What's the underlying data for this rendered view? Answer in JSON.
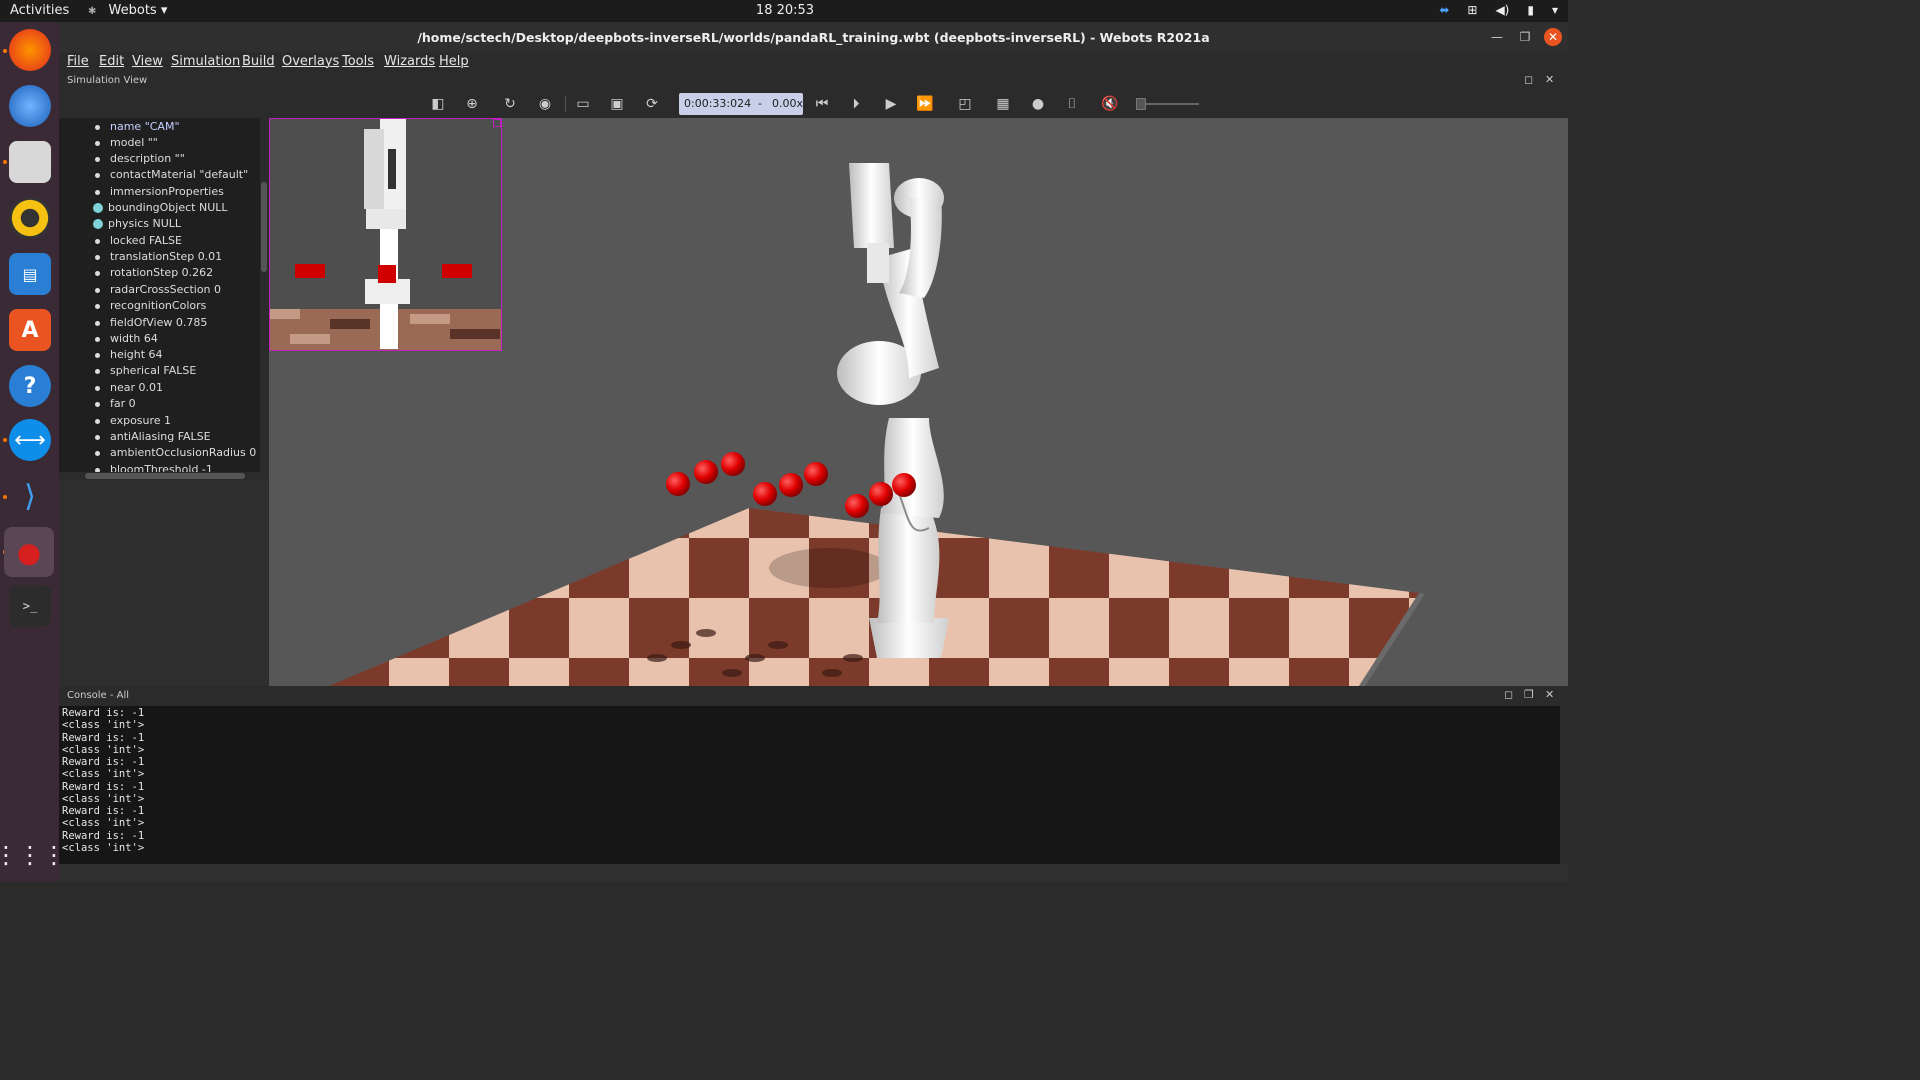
{
  "topbar": {
    "activities": "Activities",
    "app_name": "Webots ▾",
    "clock": "18  20:53"
  },
  "window": {
    "title": "/home/sctech/Desktop/deepbots-inverseRL/worlds/pandaRL_training.wbt (deepbots-inverseRL) - Webots R2021a"
  },
  "menu": [
    "File",
    "Edit",
    "View",
    "Simulation",
    "Build",
    "Overlays",
    "Tools",
    "Wizards",
    "Help"
  ],
  "sim_view": {
    "header": "Simulation View",
    "time": "0:00:33:024",
    "speed_sep": "-",
    "speed": "0.00x"
  },
  "scene_tree": {
    "fields": [
      "name \"CAM\"",
      "model \"\"",
      "description \"\"",
      "contactMaterial \"default\"",
      "immersionProperties",
      "boundingObject NULL",
      "physics NULL",
      "locked FALSE",
      "translationStep 0.01",
      "rotationStep 0.262",
      "radarCrossSection 0",
      "recognitionColors",
      "fieldOfView 0.785",
      "width 64",
      "height 64",
      "spherical FALSE",
      "near 0.01",
      "far 0",
      "exposure 1",
      "antiAliasing FALSE",
      "ambientOcclusionRadius 0",
      "bloomThreshold -1"
    ]
  },
  "console": {
    "header": "Console - All",
    "lines": [
      "Reward is: -1",
      "<class 'int'>",
      "Reward is: -1",
      "<class 'int'>",
      "Reward is: -1",
      "<class 'int'>",
      "Reward is: -1",
      "<class 'int'>",
      "Reward is: -1",
      "<class 'int'>",
      "Reward is: -1",
      "<class 'int'>"
    ]
  },
  "colors": {
    "accent_close": "#e95420",
    "time_box": "#c7d0e8",
    "camera_border": "#c020c0",
    "target_spheres": "#e00000"
  }
}
